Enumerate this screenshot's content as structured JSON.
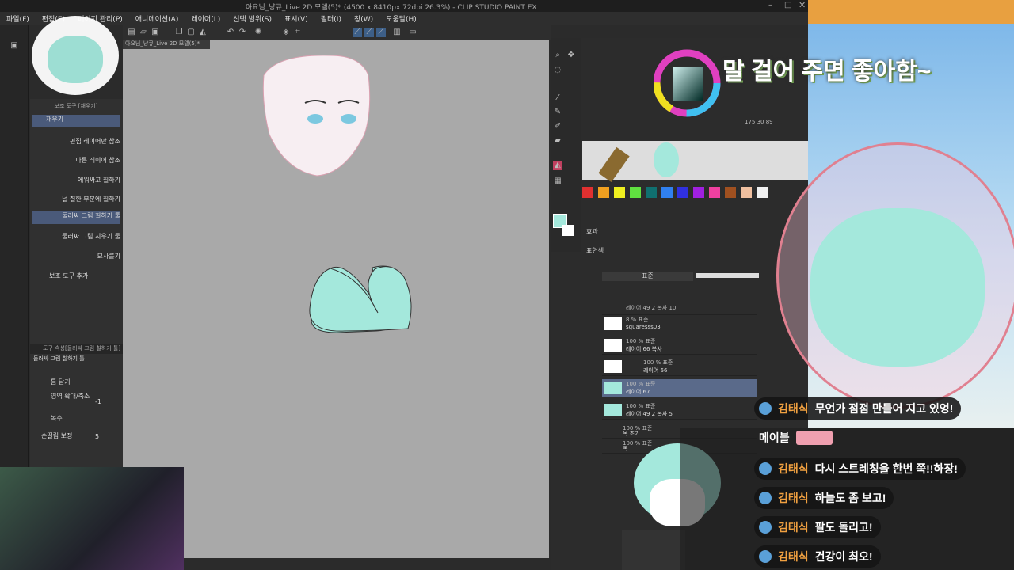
{
  "window": {
    "title": "아요님_냥큐_Live 2D 모델(5)* (4500 x 8410px 72dpi 26.3%) - CLIP STUDIO PAINT EX"
  },
  "menu": [
    "파일(F)",
    "편집(E)",
    "페이지 관리(P)",
    "애니메이션(A)",
    "레이어(L)",
    "선택 범위(S)",
    "표시(V)",
    "필터(I)",
    "창(W)",
    "도움말(H)"
  ],
  "canvas_tab": "아요님_냥큐_Live 2D 모델(5)*",
  "subtool": {
    "header": "보조 도구 [채우기]",
    "items": [
      "채우기",
      "편집 레이어만 참조",
      "다른 레이어 참조",
      "에워싸고 칠하기",
      "덜 칠한 부분에 칠하기",
      "둘러싸 그림 칠하기 툴",
      "둘러싸 그림 지우기 툴",
      "묘사를기"
    ],
    "add_label": "보조 도구 추가"
  },
  "tool_property": {
    "header": "도구 속성[둘러싸 그림 칠하기 툴]",
    "title": "둘러싸 그림 칠하기 툴",
    "close_gaps": "틈 닫기",
    "expand": "영역 확대/축소",
    "expand_value": "-1",
    "multi": "복수",
    "antialias": "손떨림 보정",
    "antialias_value": "5"
  },
  "color_panel": {
    "readout": "175 30 89"
  },
  "layer_panel": {
    "blend": "표준",
    "effect_label": "효과",
    "expression_label": "표현색",
    "layers": [
      {
        "top": "레이어 49 2 복사 10",
        "bottom": ""
      },
      {
        "top": "8 % 표준",
        "bottom": "squaresss03"
      },
      {
        "top": "100 % 표준",
        "bottom": "레이어 66 복사"
      },
      {
        "top": "100 % 표준",
        "bottom": "레이어 66"
      },
      {
        "top": "100 % 표준",
        "bottom": "레이어 67"
      },
      {
        "top": "100 % 표준",
        "bottom": "레이어 49 2 복사 5"
      },
      {
        "top": "100 % 표준",
        "bottom": "목 조기"
      },
      {
        "top": "100 % 표준",
        "bottom": "목"
      }
    ]
  },
  "overlay_text": "말 걸어 주면 좋아함~",
  "chat": [
    {
      "nick": "김태식",
      "msg": "무언가 점점 만들어 지고 있엉!"
    },
    {
      "nick": "메이블",
      "msg": ""
    },
    {
      "nick": "김태식",
      "msg": "다시 스트레칭을 한번 쭉!!하장!"
    },
    {
      "nick": "김태식",
      "msg": "하늘도 좀 보고!"
    },
    {
      "nick": "김태식",
      "msg": "팔도 돌리고!"
    },
    {
      "nick": "김태식",
      "msg": "건강이 최오!"
    }
  ],
  "colors": {
    "mint": "#a4e8dc",
    "canvas_bg": "#a9a9a9",
    "selected_layer": "#5a6a8a",
    "chat_nick": "#f0a040"
  }
}
